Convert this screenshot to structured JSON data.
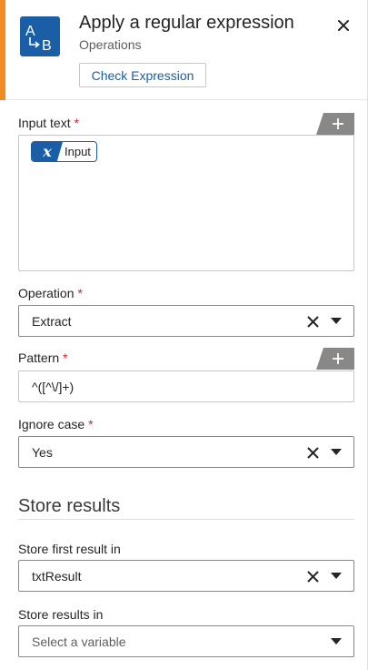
{
  "header": {
    "title": "Apply a regular expression",
    "subtitle": "Operations",
    "check_expression_label": "Check Expression",
    "accent_color": "#f08a24",
    "icon_color": "#1b5ea8",
    "icon_letters": [
      "A",
      "B"
    ]
  },
  "fields": {
    "input_text": {
      "label": "Input text",
      "required_mark": "*",
      "chip_symbol": "x",
      "chip_label": "Input"
    },
    "operation": {
      "label": "Operation",
      "required_mark": "*",
      "value": "Extract"
    },
    "pattern": {
      "label": "Pattern",
      "required_mark": "*",
      "value": "^([^\\/]+)"
    },
    "ignore_case": {
      "label": "Ignore case",
      "required_mark": "*",
      "value": "Yes"
    }
  },
  "store": {
    "section_title": "Store results",
    "first_result": {
      "label": "Store first result in",
      "value": "txtResult"
    },
    "results": {
      "label": "Store results in",
      "placeholder": "Select a variable"
    }
  },
  "icons": {
    "close": "close-icon",
    "add": "plus-icon",
    "clear": "clear-icon",
    "chevron": "chevron-down-icon"
  }
}
